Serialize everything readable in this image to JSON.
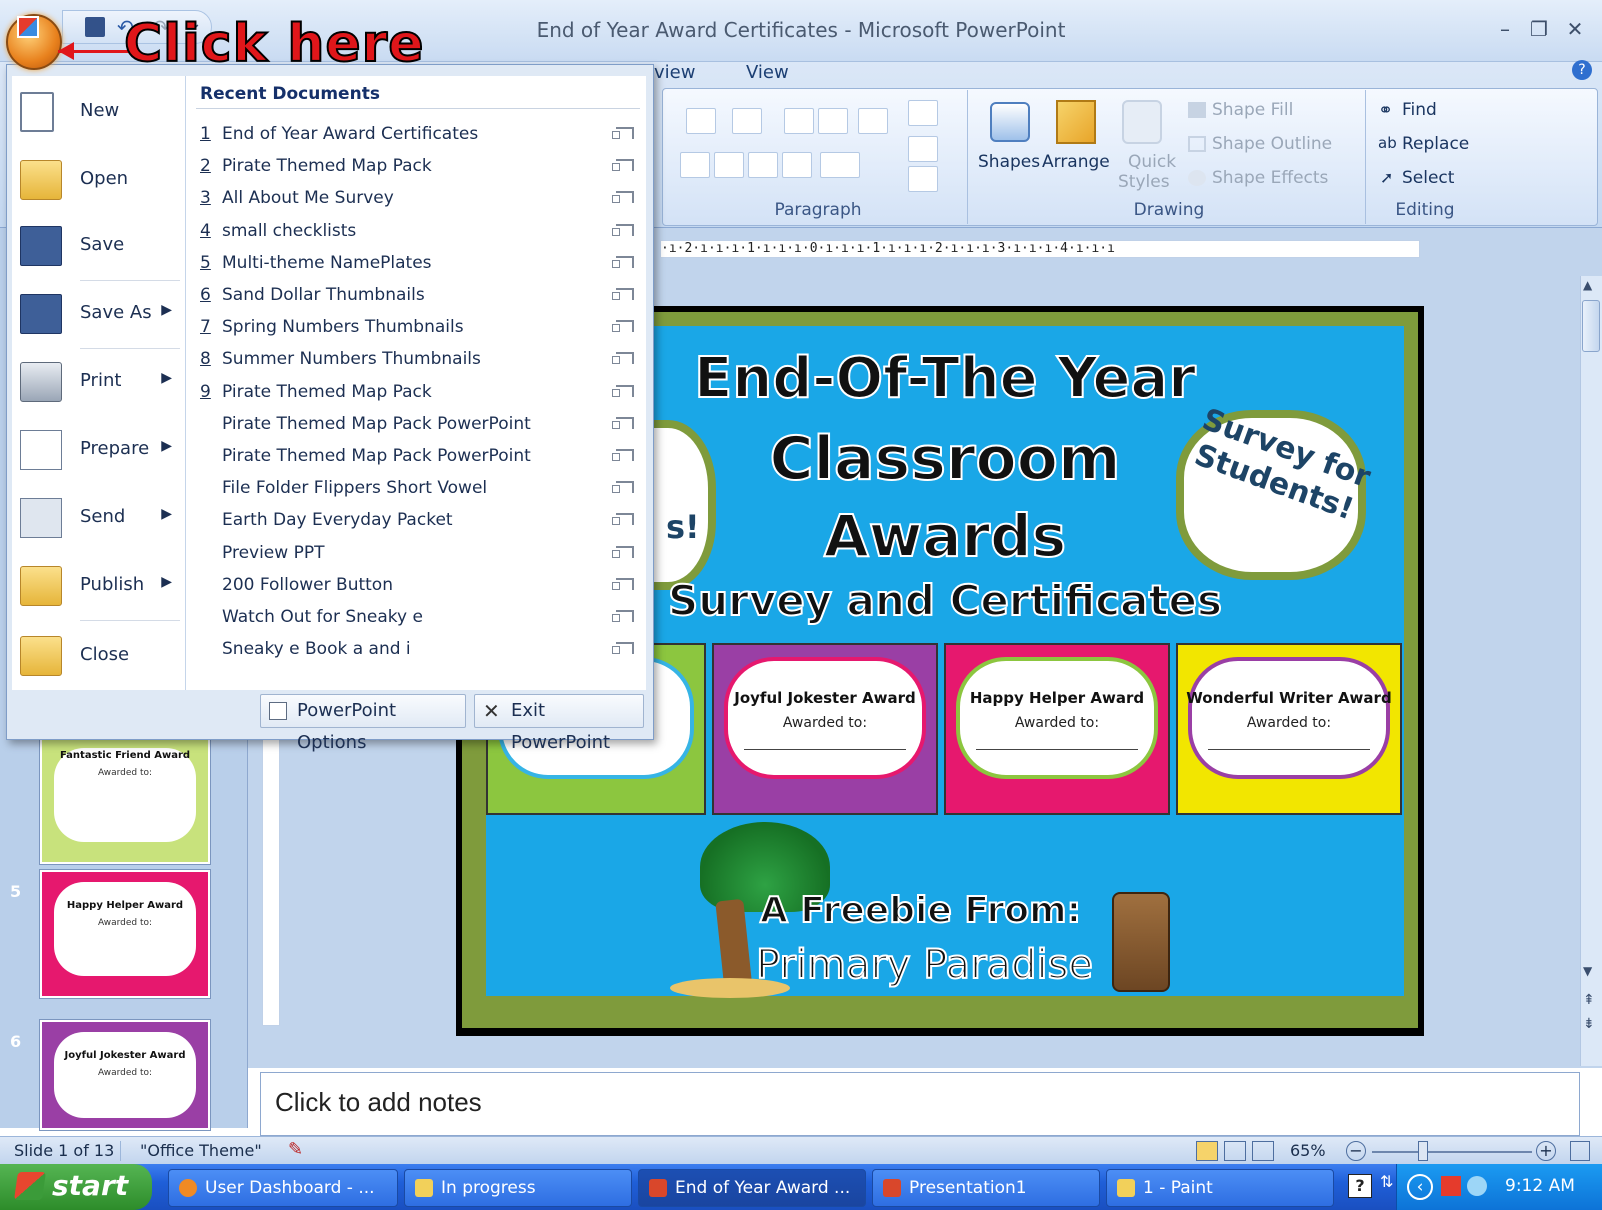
{
  "window": {
    "title": "End of Year Award Certificates - Microsoft PowerPoint",
    "min": "–",
    "restore": "❐",
    "close": "✕"
  },
  "annotation": {
    "text": "Click here"
  },
  "ribbon": {
    "tabs": [
      "view",
      "View"
    ],
    "groups": {
      "paragraph": "Paragraph",
      "drawing": "Drawing",
      "editing": "Editing"
    },
    "drawing_items": {
      "shapes": "Shapes",
      "arrange": "Arrange",
      "quick_styles_1": "Quick",
      "quick_styles_2": "Styles",
      "shape_fill": "Shape Fill",
      "shape_outline": "Shape Outline",
      "shape_effects": "Shape Effects"
    },
    "editing_items": {
      "find": "Find",
      "replace": "Replace",
      "select": "Select"
    }
  },
  "ruler": {
    "text": "·ı·2·ı·ı·ı·1·ı·ı·ı·0·ı·ı·ı·1·ı·ı·ı·2·ı·ı·ı·3·ı·ı·ı·4·ı·ı·ı"
  },
  "office_menu": {
    "left_items": [
      {
        "label": "New",
        "icon": "new-document-icon",
        "arrow": ""
      },
      {
        "label": "Open",
        "icon": "open-folder-icon",
        "arrow": ""
      },
      {
        "label": "Save",
        "icon": "floppy-disk-icon",
        "arrow": ""
      },
      {
        "label": "Save As",
        "icon": "save-as-icon",
        "arrow": "▶"
      },
      {
        "label": "Print",
        "icon": "printer-icon",
        "arrow": "▶"
      },
      {
        "label": "Prepare",
        "icon": "prepare-icon",
        "arrow": "▶"
      },
      {
        "label": "Send",
        "icon": "send-icon",
        "arrow": "▶"
      },
      {
        "label": "Publish",
        "icon": "publish-icon",
        "arrow": "▶"
      },
      {
        "label": "Close",
        "icon": "close-folder-icon",
        "arrow": ""
      }
    ],
    "recent_title": "Recent Documents",
    "recent": [
      {
        "num": "1",
        "label": "End of Year Award Certificates"
      },
      {
        "num": "2",
        "label": "Pirate Themed Map Pack"
      },
      {
        "num": "3",
        "label": "All About Me Survey"
      },
      {
        "num": "4",
        "label": "small checklists"
      },
      {
        "num": "5",
        "label": "Multi-theme NamePlates"
      },
      {
        "num": "6",
        "label": "Sand Dollar Thumbnails"
      },
      {
        "num": "7",
        "label": "Spring Numbers Thumbnails"
      },
      {
        "num": "8",
        "label": "Summer Numbers Thumbnails"
      },
      {
        "num": "9",
        "label": "Pirate Themed Map Pack"
      },
      {
        "num": "",
        "label": "Pirate Themed Map Pack PowerPoint"
      },
      {
        "num": "",
        "label": "Pirate Themed Map Pack PowerPoint"
      },
      {
        "num": "",
        "label": "File Folder Flippers Short Vowel"
      },
      {
        "num": "",
        "label": "Earth Day Everyday Packet"
      },
      {
        "num": "",
        "label": "Preview PPT"
      },
      {
        "num": "",
        "label": "200 Follower Button"
      },
      {
        "num": "",
        "label": "Watch Out for Sneaky e"
      },
      {
        "num": "",
        "label": "Sneaky e Book a and i"
      }
    ],
    "options_button": "PowerPoint Options",
    "exit_button": "Exit PowerPoint"
  },
  "slides_pane": {
    "thumbs": [
      {
        "num": "",
        "title": "Fantastic Friend Award",
        "sub": "Awarded to:",
        "color": "#c8e27c"
      },
      {
        "num": "5",
        "title": "Happy Helper Award",
        "sub": "Awarded to:",
        "color": "#e6186e"
      },
      {
        "num": "6",
        "title": "Joyful Jokester Award",
        "sub": "Awarded to:",
        "color": "#9a3fa5"
      }
    ]
  },
  "slide": {
    "title1": "End-Of-The Year",
    "title2": "Classroom",
    "title3": "Awards",
    "subtitle": "Survey and Certificates",
    "badge_left": "s!",
    "badge_right": "Survey for Students!",
    "certs": [
      {
        "title": "",
        "sub": "",
        "color": "#8cc63f",
        "cloud": "#36b4e5"
      },
      {
        "title": "Joyful Jokester Award",
        "sub": "Awarded to:",
        "color": "#9a3fa5",
        "cloud": "#e6186e"
      },
      {
        "title": "Happy Helper Award",
        "sub": "Awarded to:",
        "color": "#e6186e",
        "cloud": "#8cc63f"
      },
      {
        "title": "Wonderful Writer Award",
        "sub": "Awarded to:",
        "color": "#f2e600",
        "cloud": "#9a3fa5"
      }
    ],
    "freebie": "A Freebie From:",
    "brand": "Primary Paradise"
  },
  "notes": {
    "placeholder": "Click to add notes"
  },
  "status": {
    "slide": "Slide 1 of 13",
    "theme": "\"Office Theme\"",
    "zoom": "65%"
  },
  "taskbar": {
    "start": "start",
    "tasks": [
      {
        "label": "User Dashboard - ...",
        "icon": "firefox-icon",
        "color": "#f08a24"
      },
      {
        "label": "In progress",
        "icon": "folder-icon",
        "color": "#f2d05a"
      },
      {
        "label": "End of Year Award ...",
        "icon": "powerpoint-icon",
        "color": "#d9472b"
      },
      {
        "label": "Presentation1",
        "icon": "powerpoint-icon",
        "color": "#d9472b"
      },
      {
        "label": "1 - Paint",
        "icon": "paint-icon",
        "color": "#f2d05a"
      }
    ],
    "time": "9:12 AM"
  },
  "colors": {
    "slide_bg": "#1aa7e7",
    "slide_border": "#7f9b3c",
    "annotation": "#e0161a"
  }
}
